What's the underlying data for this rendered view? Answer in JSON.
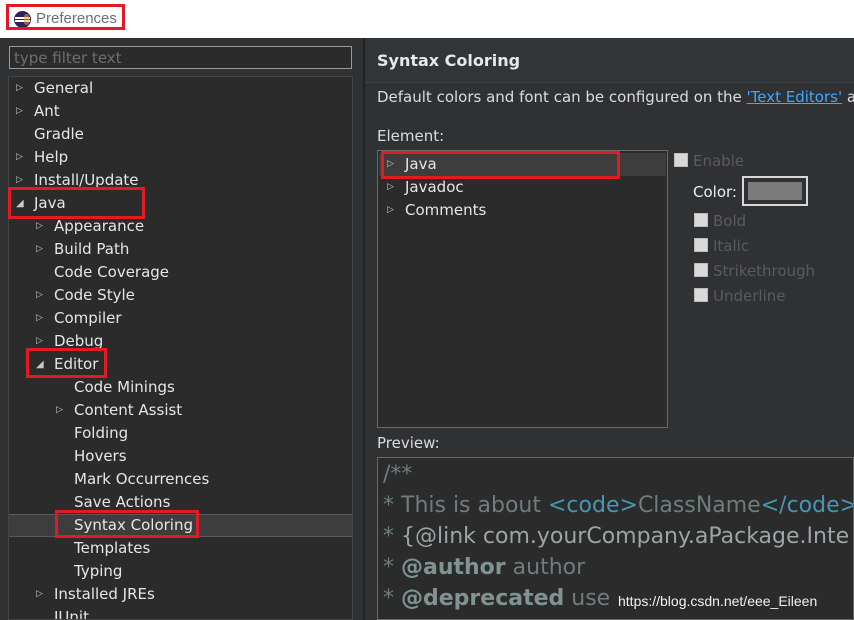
{
  "window": {
    "title": "Preferences"
  },
  "filter": {
    "placeholder": "type filter text"
  },
  "tree": {
    "general": "General",
    "ant": "Ant",
    "gradle": "Gradle",
    "help": "Help",
    "install_update": "Install/Update",
    "java": "Java",
    "appearance": "Appearance",
    "build_path": "Build Path",
    "code_coverage": "Code Coverage",
    "code_style": "Code Style",
    "compiler": "Compiler",
    "debug": "Debug",
    "editor": "Editor",
    "code_minings": "Code Minings",
    "content_assist": "Content Assist",
    "folding": "Folding",
    "hovers": "Hovers",
    "mark_occurrences": "Mark Occurrences",
    "save_actions": "Save Actions",
    "syntax_coloring": "Syntax Coloring",
    "templates": "Templates",
    "typing": "Typing",
    "installed_jres": "Installed JREs",
    "junit": "JUnit"
  },
  "page": {
    "title": "Syntax Coloring",
    "desc_prefix": "Default colors and font can be configured on the ",
    "desc_link": "'Text Editors'",
    "desc_suffix": " and"
  },
  "element": {
    "label": "Element:",
    "items": {
      "java": "Java",
      "javadoc": "Javadoc",
      "comments": "Comments"
    }
  },
  "options": {
    "enable": "Enable",
    "color": "Color:",
    "bold": "Bold",
    "italic": "Italic",
    "strikethrough": "Strikethrough",
    "underline": "Underline",
    "color_value": "#7b7b7b"
  },
  "preview": {
    "label": "Preview:",
    "l1": "/**",
    "l2_star": " * ",
    "l2_text": "This is about ",
    "l2_open": "<code>",
    "l2_name": "ClassName",
    "l2_close": "</code>",
    "l3_star": " * ",
    "l3_text": "{@link com.yourCompany.aPackage.Inte",
    "l4_star": " * ",
    "l4_kw": "@author",
    "l4_text": " author",
    "l5_star": " * ",
    "l5_kw": "@deprecated",
    "l5_text": " use "
  },
  "watermark": "https://blog.csdn.net/eee_Eileen",
  "colors": {
    "highlight_box": "#e01b24",
    "link": "#3fa7ff",
    "background": "#2f3133"
  }
}
